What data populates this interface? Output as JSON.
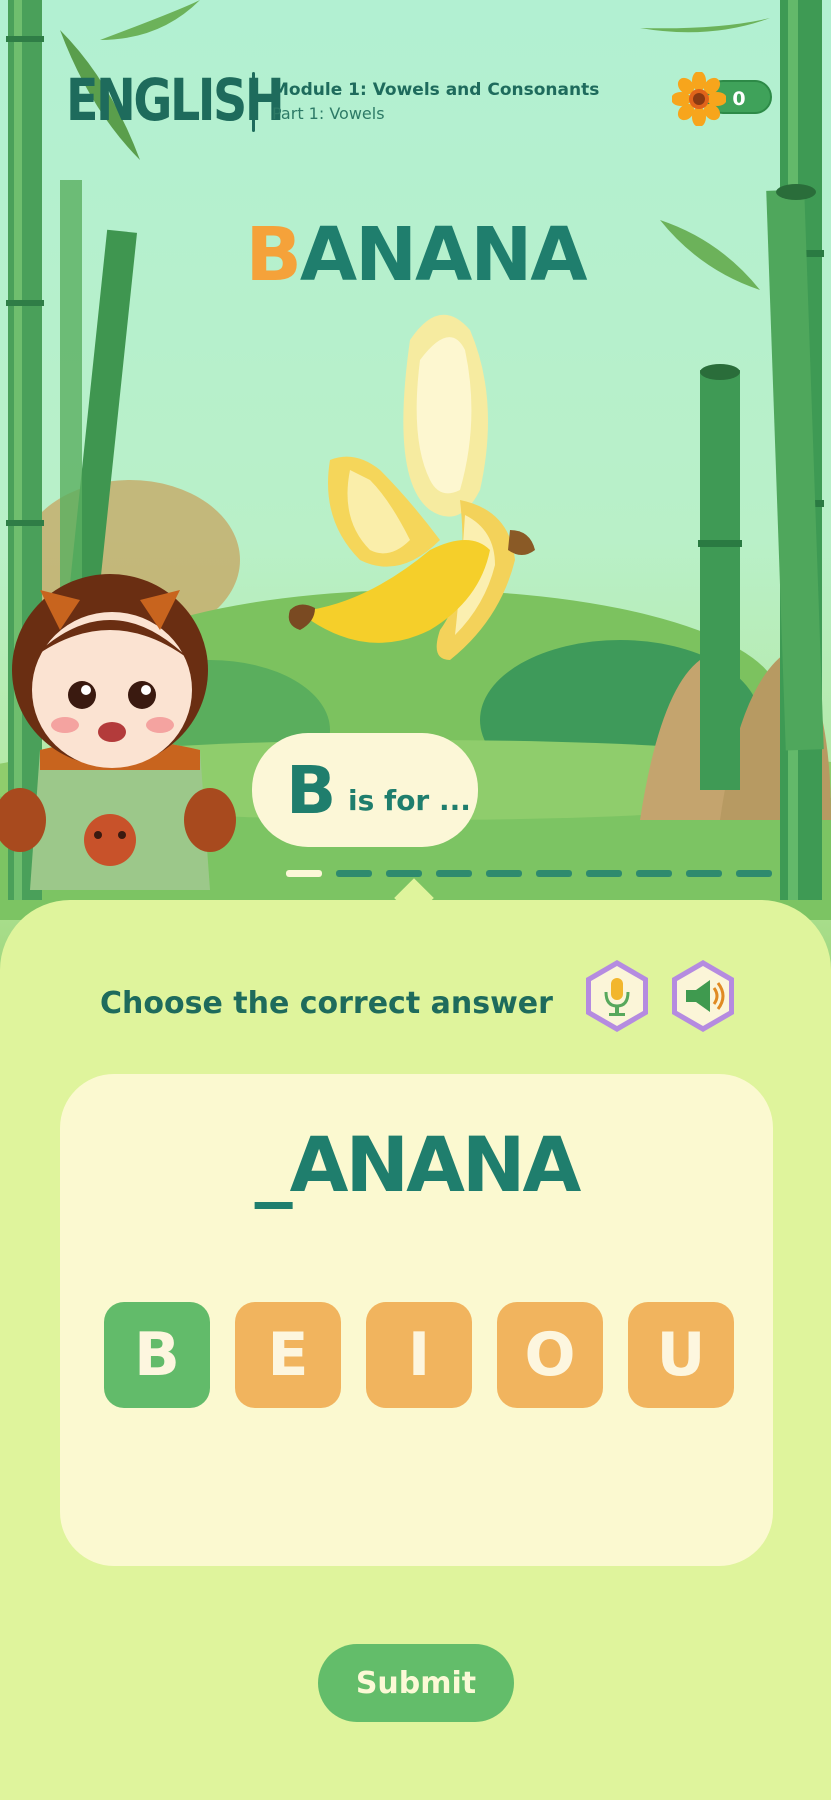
{
  "header": {
    "subject": "ENGLISH",
    "module_title": "Module 1: Vowels and Consonants",
    "module_part": "Part 1: Vowels",
    "score": "0"
  },
  "lesson": {
    "word_first_letter": "B",
    "word_rest": "ANANA",
    "bubble_letter": "B",
    "bubble_text": "is for ..."
  },
  "quiz": {
    "prompt": "Choose the correct answer",
    "blank_word": "_ANANA",
    "options": [
      "B",
      "E",
      "I",
      "O",
      "U"
    ],
    "selected": "B",
    "submit_label": "Submit"
  },
  "colors": {
    "accent_green": "#1f7e6d",
    "tile_orange": "#f1b45e",
    "tile_selected": "#62bb6a",
    "highlight_orange": "#f5a23a"
  },
  "icons": {
    "score": "sun-flower-icon",
    "mic": "microphone-icon",
    "speaker": "speaker-icon"
  }
}
